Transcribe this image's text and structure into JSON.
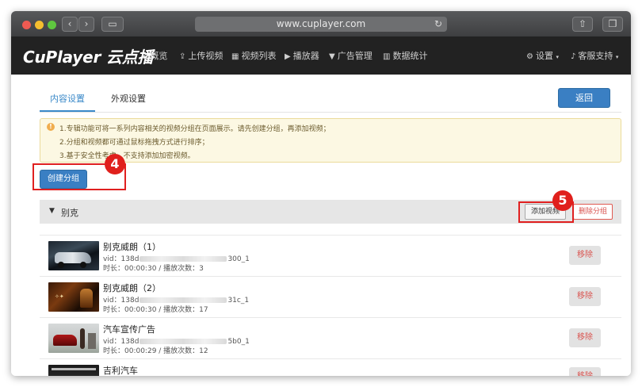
{
  "browser": {
    "url": "www.cuplayer.com"
  },
  "app": {
    "logo": "CuPlayer 云点播",
    "nav": [
      {
        "icon": "home-icon",
        "glyph": "⌂",
        "label": "概览"
      },
      {
        "icon": "upload-icon",
        "glyph": "⇪",
        "label": "上传视频"
      },
      {
        "icon": "film-icon",
        "glyph": "▦",
        "label": "视频列表"
      },
      {
        "icon": "play-circle-icon",
        "glyph": "▶",
        "label": "播放器"
      },
      {
        "icon": "filter-icon",
        "glyph": "▼",
        "label": "广告管理"
      },
      {
        "icon": "bar-chart-icon",
        "glyph": "▥",
        "label": "数据统计"
      }
    ],
    "right_nav": [
      {
        "icon": "gear-icon",
        "glyph": "⚙",
        "label": "设置"
      },
      {
        "icon": "bell-icon",
        "glyph": "♪",
        "label": "客服支持"
      }
    ]
  },
  "tabs": [
    "内容设置",
    "外观设置"
  ],
  "back_label": "返回",
  "notice": [
    "1.专辑功能可将一系列内容相关的视频分组在页面展示。请先创建分组，再添加视频；",
    "2.分组和视频都可通过鼠标拖拽方式进行排序；",
    "3.基于安全性考虑，不支持添加加密视频。"
  ],
  "create_group_label": "创建分组",
  "annotations": {
    "step4": "4",
    "step5": "5"
  },
  "group": {
    "name": "别克",
    "add_video_label": "添加视频",
    "delete_group_label": "删除分组"
  },
  "videos": [
    {
      "title": "别克威朗（1）",
      "vid_prefix": "vid：138d",
      "vid_suffix": "300_1",
      "duration": "时长：00:00:30 / 播放次数：3",
      "remove_label": "移除"
    },
    {
      "title": "别克威朗（2）",
      "vid_prefix": "vid：138d",
      "vid_suffix": "31c_1",
      "duration": "时长：00:00:30 / 播放次数：17",
      "remove_label": "移除"
    },
    {
      "title": "汽车宣传广告",
      "vid_prefix": "vid：138d",
      "vid_suffix": "5b0_1",
      "duration": "时长：00:00:29 / 播放次数：12",
      "remove_label": "移除"
    },
    {
      "title": "吉利汽车",
      "vid_prefix": "",
      "vid_suffix": "",
      "duration": "",
      "remove_label": "移除"
    }
  ]
}
